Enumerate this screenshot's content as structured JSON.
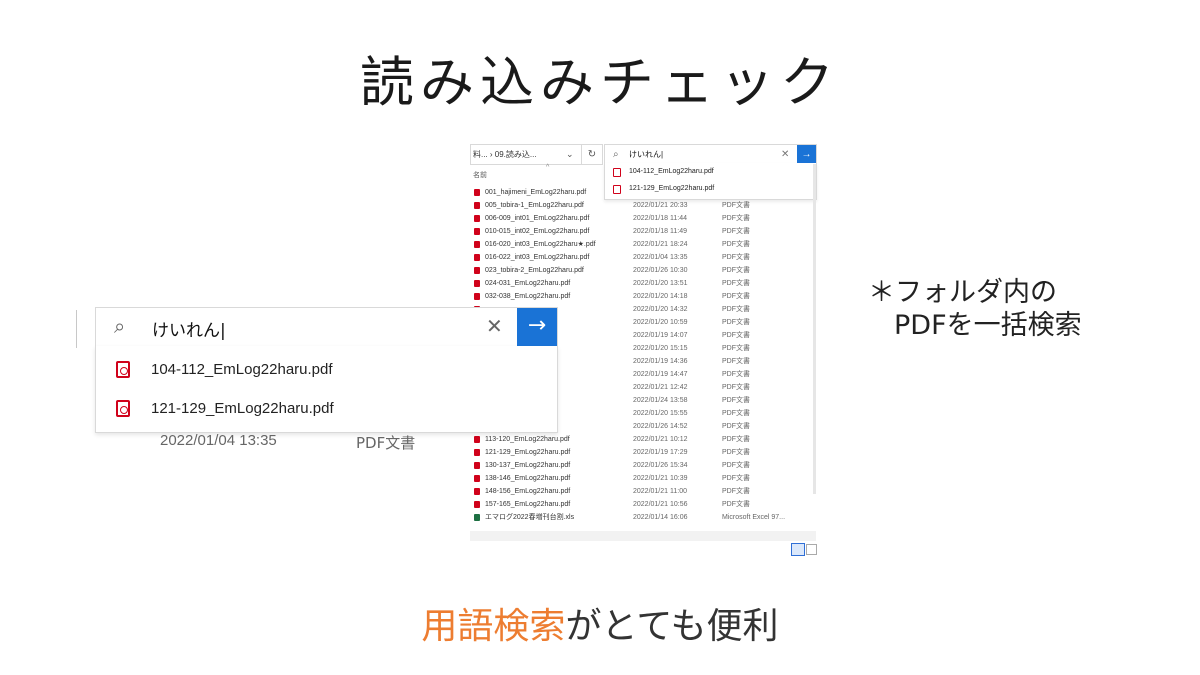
{
  "title": "読み込みチェック",
  "note": {
    "line1": "＊フォルダ内の",
    "line2": "PDFを一括検索"
  },
  "bottom": {
    "highlight": "用語検索",
    "rest": "がとても便利",
    "highlight_color": "#ed7d31"
  },
  "explorer": {
    "address_path": "料... › 09.読み込...",
    "drop_icon": "chevron-down-icon",
    "refresh_icon": "refresh-icon",
    "search_value": "けいれん|",
    "column_name": "名前",
    "search_results": [
      "104-112_EmLog22haru.pdf",
      "121-129_EmLog22haru.pdf"
    ],
    "files": [
      {
        "name": "001_hajimeni_EmLog22haru.pdf",
        "date": "2022/01/04 13:35",
        "type": "PDF文書",
        "kind": "pdf"
      },
      {
        "name": "005_tobira-1_EmLog22haru.pdf",
        "date": "2022/01/21 20:33",
        "type": "PDF文書",
        "kind": "pdf"
      },
      {
        "name": "006-009_int01_EmLog22haru.pdf",
        "date": "2022/01/18 11:44",
        "type": "PDF文書",
        "kind": "pdf"
      },
      {
        "name": "010-015_int02_EmLog22haru.pdf",
        "date": "2022/01/18 11:49",
        "type": "PDF文書",
        "kind": "pdf"
      },
      {
        "name": "016-020_int03_EmLog22haru★.pdf",
        "date": "2022/01/21 18:24",
        "type": "PDF文書",
        "kind": "pdf"
      },
      {
        "name": "016-022_int03_EmLog22haru.pdf",
        "date": "2022/01/04 13:35",
        "type": "PDF文書",
        "kind": "pdf"
      },
      {
        "name": "023_tobira-2_EmLog22haru.pdf",
        "date": "2022/01/26 10:30",
        "type": "PDF文書",
        "kind": "pdf"
      },
      {
        "name": "024-031_EmLog22haru.pdf",
        "date": "2022/01/20 13:51",
        "type": "PDF文書",
        "kind": "pdf"
      },
      {
        "name": "032-038_EmLog22haru.pdf",
        "date": "2022/01/20 14:18",
        "type": "PDF文書",
        "kind": "pdf"
      },
      {
        "name": "",
        "date": "2022/01/20 14:32",
        "type": "PDF文書",
        "kind": "pdf"
      },
      {
        "name": "",
        "date": "2022/01/20 10:59",
        "type": "PDF文書",
        "kind": "pdf"
      },
      {
        "name": "",
        "date": "2022/01/19 14:07",
        "type": "PDF文書",
        "kind": "pdf"
      },
      {
        "name": "",
        "date": "2022/01/20 15:15",
        "type": "PDF文書",
        "kind": "pdf"
      },
      {
        "name": "",
        "date": "2022/01/19 14:36",
        "type": "PDF文書",
        "kind": "pdf"
      },
      {
        "name": "",
        "date": "2022/01/19 14:47",
        "type": "PDF文書",
        "kind": "pdf"
      },
      {
        "name": "",
        "date": "2022/01/21 12:42",
        "type": "PDF文書",
        "kind": "pdf"
      },
      {
        "name": "",
        "date": "2022/01/24 13:58",
        "type": "PDF文書",
        "kind": "pdf"
      },
      {
        "name": "",
        "date": "2022/01/20 15:55",
        "type": "PDF文書",
        "kind": "pdf"
      },
      {
        "name": "",
        "date": "2022/01/26 14:52",
        "type": "PDF文書",
        "kind": "pdf"
      },
      {
        "name": "113-120_EmLog22haru.pdf",
        "date": "2022/01/21 10:12",
        "type": "PDF文書",
        "kind": "pdf"
      },
      {
        "name": "121-129_EmLog22haru.pdf",
        "date": "2022/01/19 17:29",
        "type": "PDF文書",
        "kind": "pdf"
      },
      {
        "name": "130-137_EmLog22haru.pdf",
        "date": "2022/01/26 15:34",
        "type": "PDF文書",
        "kind": "pdf"
      },
      {
        "name": "138-146_EmLog22haru.pdf",
        "date": "2022/01/21 10:39",
        "type": "PDF文書",
        "kind": "pdf"
      },
      {
        "name": "148-156_EmLog22haru.pdf",
        "date": "2022/01/21 11:00",
        "type": "PDF文書",
        "kind": "pdf"
      },
      {
        "name": "157-165_EmLog22haru.pdf",
        "date": "2022/01/21 10:56",
        "type": "PDF文書",
        "kind": "pdf"
      },
      {
        "name": "エマログ2022春増刊台割.xls",
        "date": "2022/01/14 16:06",
        "type": "Microsoft Excel 97...",
        "kind": "xls"
      }
    ]
  },
  "zoom": {
    "search_value": "けいれん|",
    "results": [
      "104-112_EmLog22haru.pdf",
      "121-129_EmLog22haru.pdf"
    ],
    "below_date": "2022/01/04 13:35",
    "below_type": "PDF文書"
  }
}
